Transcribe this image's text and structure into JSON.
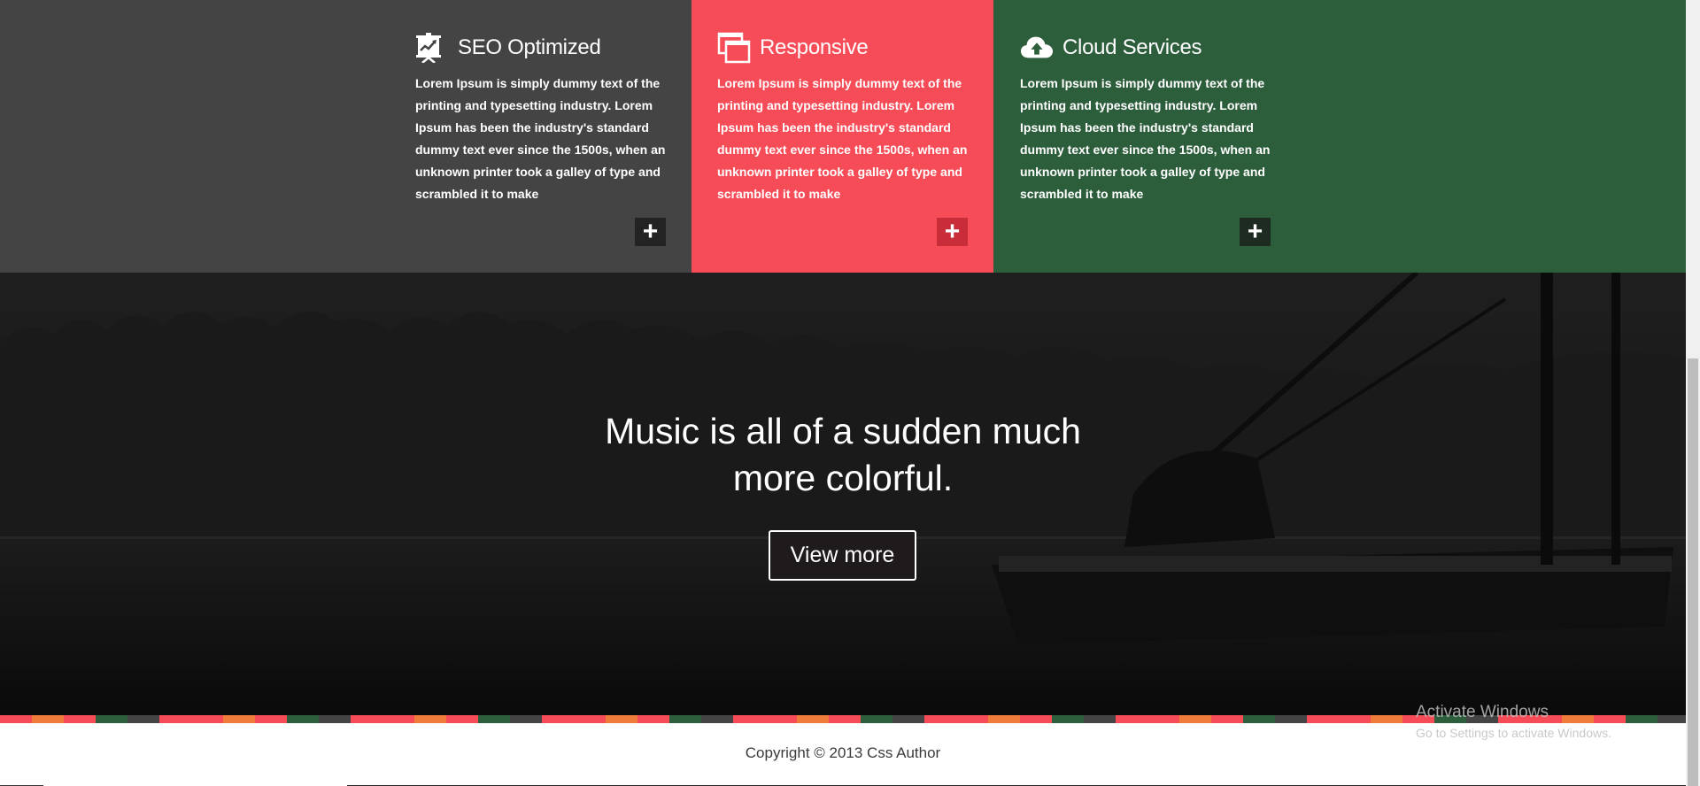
{
  "features": [
    {
      "title": "SEO Optimized",
      "icon": "presentation-chart-icon",
      "text": "Lorem Ipsum is simply dummy text of the printing and typesetting industry. Lorem Ipsum has been the industry's standard dummy text ever since the 1500s, when an unknown printer took a galley of type and scrambled it to make",
      "bg_color": "#444444",
      "button_label": "+",
      "button_color": "#232323"
    },
    {
      "title": "Responsive",
      "icon": "stacked-windows-icon",
      "text": "Lorem Ipsum is simply dummy text of the printing and typesetting industry. Lorem Ipsum has been the industry's standard dummy text ever since the 1500s, when an unknown printer took a galley of type and scrambled it to make",
      "bg_color": "#f64c57",
      "button_label": "+",
      "button_color": "#c92d3a"
    },
    {
      "title": "Cloud Services",
      "icon": "cloud-upload-icon",
      "text": "Lorem Ipsum is simply dummy text of the printing and typesetting industry. Lorem Ipsum has been the industry's standard dummy text ever since the 1500s, when an unknown printer took a galley of type and scrambled it to make",
      "bg_color": "#2d5e3c",
      "button_label": "+",
      "button_color": "#1d2b21"
    }
  ],
  "hero": {
    "heading_line1": "Music is all of a sudden much",
    "heading_line2": "more colorful.",
    "button_label": "View more"
  },
  "stripe_colors": [
    "#f64c57",
    "#f07c3a",
    "#2d5e3c",
    "#444444"
  ],
  "footer": {
    "copyright": "Copyright © 2013 Css Author"
  },
  "watermark": {
    "title": "Activate Windows",
    "subtitle": "Go to Settings to activate Windows."
  }
}
